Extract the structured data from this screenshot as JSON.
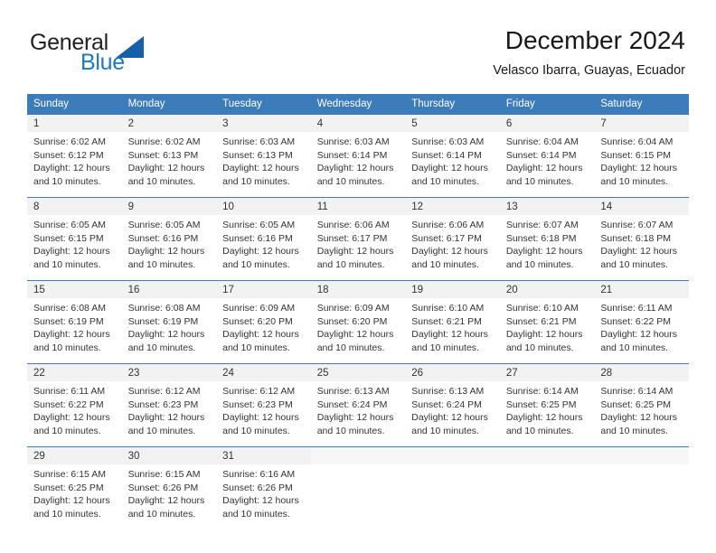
{
  "brand": {
    "name_top": "General",
    "name_bottom": "Blue",
    "color_dark": "#231f20",
    "color_blue": "#1f78c1",
    "triangle_color": "#1560a8"
  },
  "header": {
    "title": "December 2024",
    "subtitle": "Velasco Ibarra, Guayas, Ecuador"
  },
  "theme": {
    "header_row_bg": "#3c7cba",
    "header_row_text": "#ffffff",
    "daynum_bg": "#f2f2f2",
    "body_text": "#333333"
  },
  "weekdays": [
    "Sunday",
    "Monday",
    "Tuesday",
    "Wednesday",
    "Thursday",
    "Friday",
    "Saturday"
  ],
  "labels": {
    "sunrise_prefix": "Sunrise: ",
    "sunset_prefix": "Sunset: ",
    "daylight_prefix": "Daylight: "
  },
  "weeks": [
    [
      {
        "day": "1",
        "sunrise": "Sunrise: 6:02 AM",
        "sunset": "Sunset: 6:12 PM",
        "daylight": "Daylight: 12 hours and 10 minutes."
      },
      {
        "day": "2",
        "sunrise": "Sunrise: 6:02 AM",
        "sunset": "Sunset: 6:13 PM",
        "daylight": "Daylight: 12 hours and 10 minutes."
      },
      {
        "day": "3",
        "sunrise": "Sunrise: 6:03 AM",
        "sunset": "Sunset: 6:13 PM",
        "daylight": "Daylight: 12 hours and 10 minutes."
      },
      {
        "day": "4",
        "sunrise": "Sunrise: 6:03 AM",
        "sunset": "Sunset: 6:14 PM",
        "daylight": "Daylight: 12 hours and 10 minutes."
      },
      {
        "day": "5",
        "sunrise": "Sunrise: 6:03 AM",
        "sunset": "Sunset: 6:14 PM",
        "daylight": "Daylight: 12 hours and 10 minutes."
      },
      {
        "day": "6",
        "sunrise": "Sunrise: 6:04 AM",
        "sunset": "Sunset: 6:14 PM",
        "daylight": "Daylight: 12 hours and 10 minutes."
      },
      {
        "day": "7",
        "sunrise": "Sunrise: 6:04 AM",
        "sunset": "Sunset: 6:15 PM",
        "daylight": "Daylight: 12 hours and 10 minutes."
      }
    ],
    [
      {
        "day": "8",
        "sunrise": "Sunrise: 6:05 AM",
        "sunset": "Sunset: 6:15 PM",
        "daylight": "Daylight: 12 hours and 10 minutes."
      },
      {
        "day": "9",
        "sunrise": "Sunrise: 6:05 AM",
        "sunset": "Sunset: 6:16 PM",
        "daylight": "Daylight: 12 hours and 10 minutes."
      },
      {
        "day": "10",
        "sunrise": "Sunrise: 6:05 AM",
        "sunset": "Sunset: 6:16 PM",
        "daylight": "Daylight: 12 hours and 10 minutes."
      },
      {
        "day": "11",
        "sunrise": "Sunrise: 6:06 AM",
        "sunset": "Sunset: 6:17 PM",
        "daylight": "Daylight: 12 hours and 10 minutes."
      },
      {
        "day": "12",
        "sunrise": "Sunrise: 6:06 AM",
        "sunset": "Sunset: 6:17 PM",
        "daylight": "Daylight: 12 hours and 10 minutes."
      },
      {
        "day": "13",
        "sunrise": "Sunrise: 6:07 AM",
        "sunset": "Sunset: 6:18 PM",
        "daylight": "Daylight: 12 hours and 10 minutes."
      },
      {
        "day": "14",
        "sunrise": "Sunrise: 6:07 AM",
        "sunset": "Sunset: 6:18 PM",
        "daylight": "Daylight: 12 hours and 10 minutes."
      }
    ],
    [
      {
        "day": "15",
        "sunrise": "Sunrise: 6:08 AM",
        "sunset": "Sunset: 6:19 PM",
        "daylight": "Daylight: 12 hours and 10 minutes."
      },
      {
        "day": "16",
        "sunrise": "Sunrise: 6:08 AM",
        "sunset": "Sunset: 6:19 PM",
        "daylight": "Daylight: 12 hours and 10 minutes."
      },
      {
        "day": "17",
        "sunrise": "Sunrise: 6:09 AM",
        "sunset": "Sunset: 6:20 PM",
        "daylight": "Daylight: 12 hours and 10 minutes."
      },
      {
        "day": "18",
        "sunrise": "Sunrise: 6:09 AM",
        "sunset": "Sunset: 6:20 PM",
        "daylight": "Daylight: 12 hours and 10 minutes."
      },
      {
        "day": "19",
        "sunrise": "Sunrise: 6:10 AM",
        "sunset": "Sunset: 6:21 PM",
        "daylight": "Daylight: 12 hours and 10 minutes."
      },
      {
        "day": "20",
        "sunrise": "Sunrise: 6:10 AM",
        "sunset": "Sunset: 6:21 PM",
        "daylight": "Daylight: 12 hours and 10 minutes."
      },
      {
        "day": "21",
        "sunrise": "Sunrise: 6:11 AM",
        "sunset": "Sunset: 6:22 PM",
        "daylight": "Daylight: 12 hours and 10 minutes."
      }
    ],
    [
      {
        "day": "22",
        "sunrise": "Sunrise: 6:11 AM",
        "sunset": "Sunset: 6:22 PM",
        "daylight": "Daylight: 12 hours and 10 minutes."
      },
      {
        "day": "23",
        "sunrise": "Sunrise: 6:12 AM",
        "sunset": "Sunset: 6:23 PM",
        "daylight": "Daylight: 12 hours and 10 minutes."
      },
      {
        "day": "24",
        "sunrise": "Sunrise: 6:12 AM",
        "sunset": "Sunset: 6:23 PM",
        "daylight": "Daylight: 12 hours and 10 minutes."
      },
      {
        "day": "25",
        "sunrise": "Sunrise: 6:13 AM",
        "sunset": "Sunset: 6:24 PM",
        "daylight": "Daylight: 12 hours and 10 minutes."
      },
      {
        "day": "26",
        "sunrise": "Sunrise: 6:13 AM",
        "sunset": "Sunset: 6:24 PM",
        "daylight": "Daylight: 12 hours and 10 minutes."
      },
      {
        "day": "27",
        "sunrise": "Sunrise: 6:14 AM",
        "sunset": "Sunset: 6:25 PM",
        "daylight": "Daylight: 12 hours and 10 minutes."
      },
      {
        "day": "28",
        "sunrise": "Sunrise: 6:14 AM",
        "sunset": "Sunset: 6:25 PM",
        "daylight": "Daylight: 12 hours and 10 minutes."
      }
    ],
    [
      {
        "day": "29",
        "sunrise": "Sunrise: 6:15 AM",
        "sunset": "Sunset: 6:25 PM",
        "daylight": "Daylight: 12 hours and 10 minutes."
      },
      {
        "day": "30",
        "sunrise": "Sunrise: 6:15 AM",
        "sunset": "Sunset: 6:26 PM",
        "daylight": "Daylight: 12 hours and 10 minutes."
      },
      {
        "day": "31",
        "sunrise": "Sunrise: 6:16 AM",
        "sunset": "Sunset: 6:26 PM",
        "daylight": "Daylight: 12 hours and 10 minutes."
      },
      {
        "day": "",
        "sunrise": "",
        "sunset": "",
        "daylight": ""
      },
      {
        "day": "",
        "sunrise": "",
        "sunset": "",
        "daylight": ""
      },
      {
        "day": "",
        "sunrise": "",
        "sunset": "",
        "daylight": ""
      },
      {
        "day": "",
        "sunrise": "",
        "sunset": "",
        "daylight": ""
      }
    ]
  ]
}
